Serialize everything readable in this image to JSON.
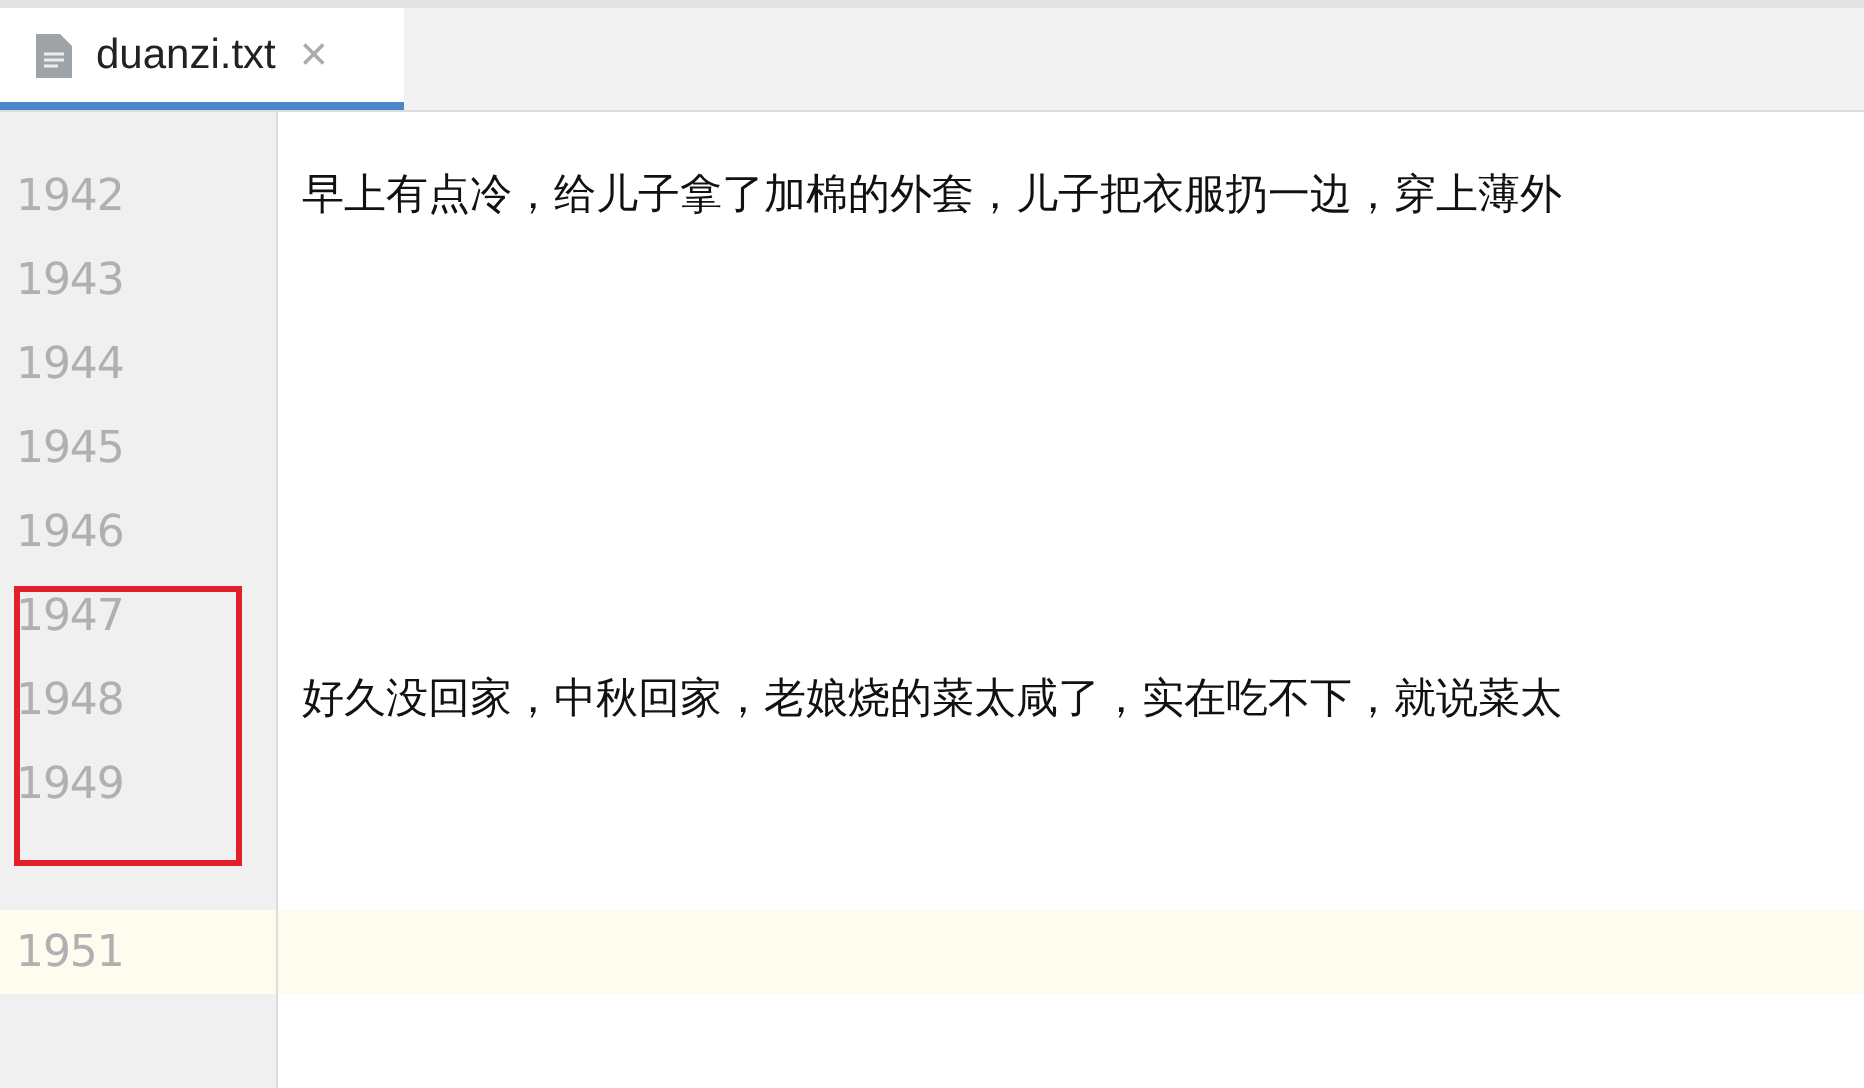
{
  "tabs": [
    {
      "label": "duanzi.txt",
      "close": "×",
      "selected": true
    }
  ],
  "lines": [
    {
      "current": false
    },
    {
      "number": "1942",
      "text": "早上有点冷，给儿子拿了加棉的外套，儿子把衣服扔一边，穿上薄外",
      "current": false
    },
    {
      "number": "1943",
      "current": false
    },
    {
      "number": "1944",
      "current": false
    },
    {
      "number": "1945",
      "current": false
    },
    {
      "number": "1946",
      "current": false
    },
    {
      "number": "1947",
      "current": false
    },
    {
      "number": "1948",
      "text": "好久没回家，中秋回家，老娘烧的菜太咸了，实在吃不下，就说菜太",
      "current": false
    },
    {
      "number": "1949",
      "current": false
    },
    {
      "current": false
    },
    {
      "number": "1951",
      "current": true
    }
  ]
}
